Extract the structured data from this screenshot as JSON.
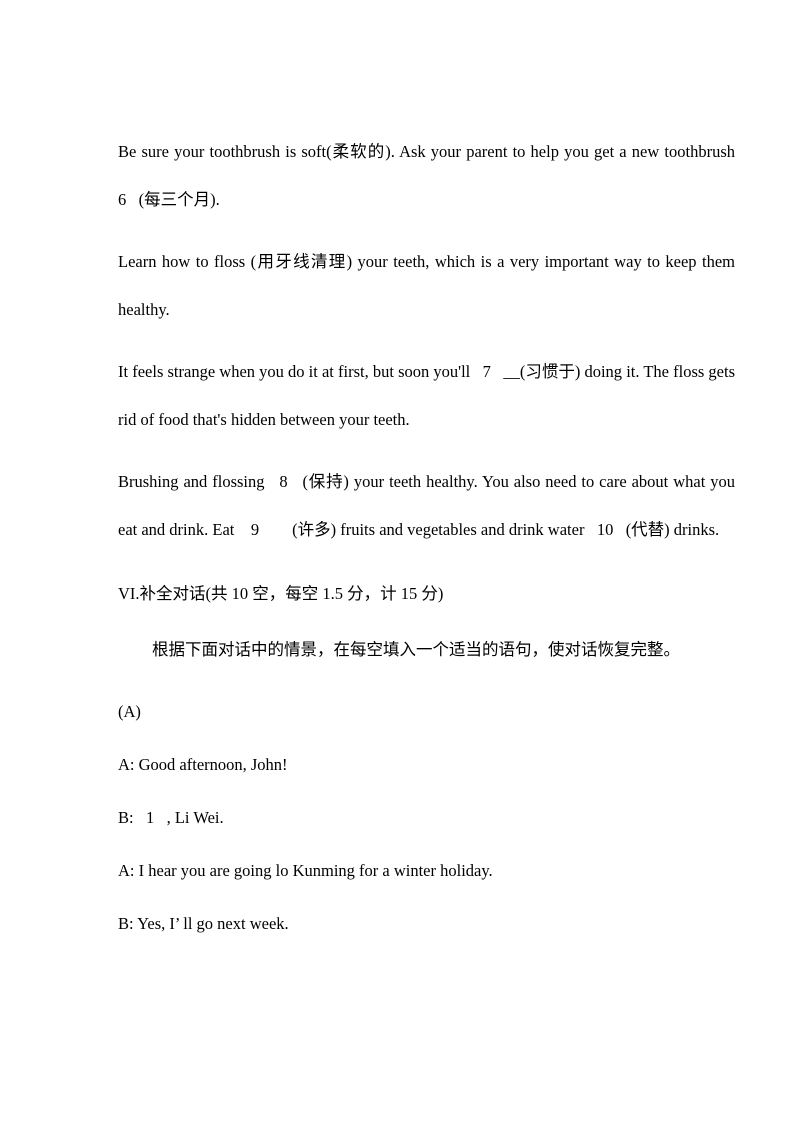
{
  "document": {
    "passage_paragraphs": [
      "Be sure your toothbrush is soft(柔软的). Ask your parent to help you get a new toothbrush    6   (每三个月).",
      "Learn how to floss (用牙线清理) your teeth, which is a very important way to keep them healthy.",
      "It feels strange when you do it at first, but soon you'll   7   __(习惯于) doing it. The floss gets rid of food that's hidden between your teeth.",
      "Brushing and flossing   8   (保持) your teeth healthy. You also need to care about what you eat and drink. Eat    9        (许多) fruits and vegetables and drink water   10   (代替) drinks."
    ],
    "section": {
      "heading": "VI.补全对话(共 10 空，每空 1.5 分，计 15 分)",
      "instruction": "根据下面对话中的情景，在每空填入一个适当的语句，使对话恢复完整。"
    },
    "dialogue": {
      "part_label": "(A)",
      "lines": [
        "A: Good afternoon, John!",
        "B:   1   , Li Wei.",
        "A: I hear you are going lo Kunming for a winter holiday.",
        "B: Yes, I’ ll go next week."
      ]
    }
  }
}
